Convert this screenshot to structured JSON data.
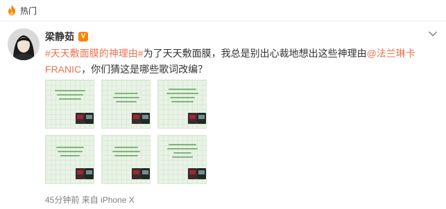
{
  "hot_bar": {
    "label": "热门"
  },
  "post": {
    "username": "梁静茹",
    "vip_badge": "V",
    "text": {
      "hashtag": "#天天敷面膜的神理由#",
      "body_1": "为了天天敷面膜，我总是别出心裁地想出这些神理由",
      "mention": "@法兰琳卡FRANIC",
      "body_2": "，你们猜这是哪些歌词改编？"
    },
    "images": [
      {
        "alt": "歌词卡片 1"
      },
      {
        "alt": "歌词卡片 2"
      },
      {
        "alt": "歌词卡片 3"
      },
      {
        "alt": "歌词卡片 4"
      },
      {
        "alt": "歌词卡片 5"
      },
      {
        "alt": "歌词卡片 6"
      }
    ],
    "meta": {
      "time": "45分钟前",
      "source": "来自 iPhone X"
    }
  },
  "colors": {
    "link": "#eb7350",
    "vip": "#ff8200",
    "hot_icon": "#ff8200",
    "meta_text": "#808080"
  },
  "icons": {
    "hot": "fire-icon",
    "more": "chevron-down-icon"
  }
}
